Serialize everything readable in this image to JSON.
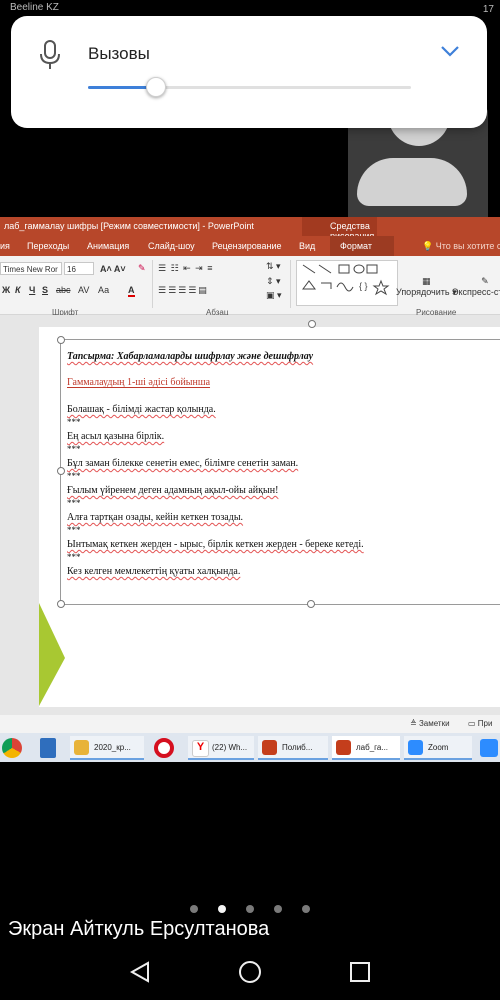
{
  "status": {
    "carrier": "Beeline KZ",
    "right": "17"
  },
  "volume_popup": {
    "label": "Вызовы",
    "level_percent": 22,
    "accent": "#3e80d9"
  },
  "ppt": {
    "title": "лаб_гаммалау шифры [Режим совместимости] - PowerPoint",
    "context_tab": "Средства рисования",
    "tabs": [
      "ия",
      "Переходы",
      "Анимация",
      "Слайд-шоу",
      "Рецензирование",
      "Вид",
      "Формат"
    ],
    "active_tab": "Формат",
    "tell_me": "Что вы хотите сде",
    "ribbon": {
      "font_name": "Times New Ror",
      "font_size": "16",
      "group_font": "Шрифт",
      "group_paragraph": "Абзац",
      "group_drawing": "Рисование",
      "arrange": "Упорядочить",
      "quick_styles": "Экспресс-стили",
      "bold": "Ж",
      "italic": "К",
      "underline": "Ч",
      "strike": "S",
      "abc": "abc",
      "case": "Аа",
      "color_a": "A"
    },
    "slide": {
      "title": "Тапсырма: Хабарламаларды шифрлау және дешифрлау",
      "subtitle": "Гаммалаудың 1-ші әдісі бойынша",
      "lines": [
        "Болашақ - білімді жастар қолында.",
        "Ең асыл қазына бірлік.",
        "Бұл заман білекке сенетін емес, білімге сенетін заман.",
        "Ғылым үйренем деген адамның ақыл-ойы айқын!",
        "Алға тартқан озады, кейін кеткен тозады.",
        "Ынтымақ кеткен жерден - ырыс, бірлік кеткен жерден - береке кетеді.",
        "Кез келген мемлекеттің қуаты  халқында."
      ],
      "separator": "***"
    },
    "statusbar": {
      "notes": "Заметки",
      "comments": "При"
    },
    "taskbar": [
      {
        "label": "2020_кр..."
      },
      {
        "label": "(22) Wh..."
      },
      {
        "label": "Полиб..."
      },
      {
        "label": "лаб_га..."
      },
      {
        "label": "Zoom"
      }
    ]
  },
  "screen_share_label": "Экран Айткуль Ерсултанова"
}
